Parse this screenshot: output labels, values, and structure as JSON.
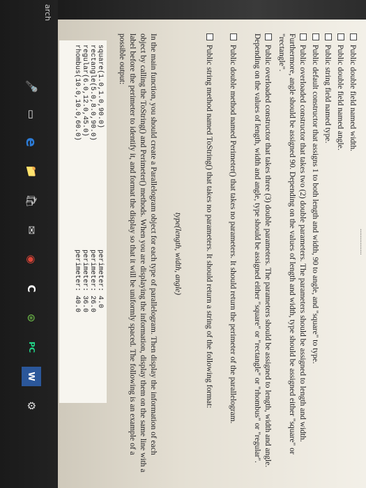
{
  "document": {
    "top_cut_text": "...............",
    "items": [
      "Public double field named width.",
      "Public double field named angle.",
      "Public string field named type.",
      "Public default constructor that assigns 1 to both length and width, 90 to angle, and \"square\" to type.",
      "Public overloaded constructor that takes two (2) double parameters. The parameters should be assigned to length and width. Furthermore, angle should be assigned 90. Depending on the values of length and width, type should be assigned either \"square\" or \"rectangle\".",
      "Public overloaded constructor that takes three (3) double parameters. The parameters should be assigned to length, width and angle. Depending on the values of length, width and angle, type should be assigned either \"square\" or \"rectangle\" or \"rhombus\" or \"regular\".",
      "Public double method named Perimeter() that takes no parameters. It should return the perimeter of the parallelogram.",
      "Public string method named ToString() that takes no parameters. It should return a string of the following format:"
    ],
    "format_line": "type(length, width, angle)",
    "main_paragraph": "In the main function, you should create a Parallelogram object for each type of parallelogram. Then display the information of each object by calling the ToString() and Perimeter() methods. When you are displaying the information, display them on the same line with a label before the perimeter to identify it, and format the display so that it will be uniformly spaced. The following is an example of a possible output:",
    "output_left": [
      "square(1.0,1.0,90.0)",
      "rectangle(5.0,8.0,90.0)",
      "regular(6.0,12.0,45.0)",
      "rhombus(10.0,10.0,60.0)"
    ],
    "output_right": [
      "perimeter: 4.0",
      "perimeter: 26.0",
      "perimeter: 36.0",
      "perimeter: 40.0"
    ]
  },
  "taskbar": {
    "search_label": "arch",
    "icons": [
      "microphone-icon",
      "task-view-icon",
      "edge-browser-icon",
      "file-explorer-icon",
      "store-icon",
      "mail-icon",
      "chrome-icon",
      "cc-app-icon",
      "xbox-icon",
      "pycharm-icon",
      "word-icon",
      "settings-icon"
    ],
    "glyphs": [
      "🎤",
      "▭",
      "e",
      "📁",
      "🛍",
      "✉",
      "◉",
      "C",
      "⊛",
      "PC",
      "W",
      "⚙"
    ],
    "colors": {
      "edge": "#2c7bd6",
      "explorer": "#e6b54a",
      "chrome": "#db4437",
      "pycharm": "#21d789",
      "word": "#2b579a"
    }
  }
}
